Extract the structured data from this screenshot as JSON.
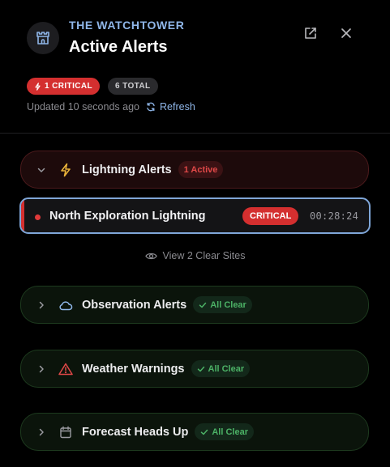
{
  "header": {
    "brand": "THE WATCHTOWER",
    "title": "Active Alerts",
    "logo_icon": "castle-icon",
    "external_icon": "external-link-icon",
    "close_icon": "close-icon"
  },
  "summary": {
    "critical_badge": "1 CRITICAL",
    "total_badge": "6 TOTAL",
    "updated_text": "Updated 10 seconds ago",
    "refresh_label": "Refresh"
  },
  "sections": {
    "lightning": {
      "label": "Lightning Alerts",
      "pill": "1 Active",
      "icon": "lightning-icon",
      "expanded": true
    },
    "observation": {
      "label": "Observation Alerts",
      "pill": "All Clear",
      "icon": "cloud-icon",
      "expanded": false
    },
    "weather": {
      "label": "Weather Warnings",
      "pill": "All Clear",
      "icon": "warning-triangle-icon",
      "expanded": false
    },
    "forecast": {
      "label": "Forecast Heads Up",
      "pill": "All Clear",
      "icon": "calendar-icon",
      "expanded": false
    }
  },
  "alert": {
    "name": "North Exploration Lightning",
    "severity": "CRITICAL",
    "timer": "00:28:24"
  },
  "view_clear_label": "View 2 Clear Sites",
  "colors": {
    "background": "#000000",
    "accent_blue": "#8fb6e8",
    "critical_red": "#d42f2f",
    "clear_green": "#4cb266",
    "lightning_yellow": "#e8b23a"
  }
}
